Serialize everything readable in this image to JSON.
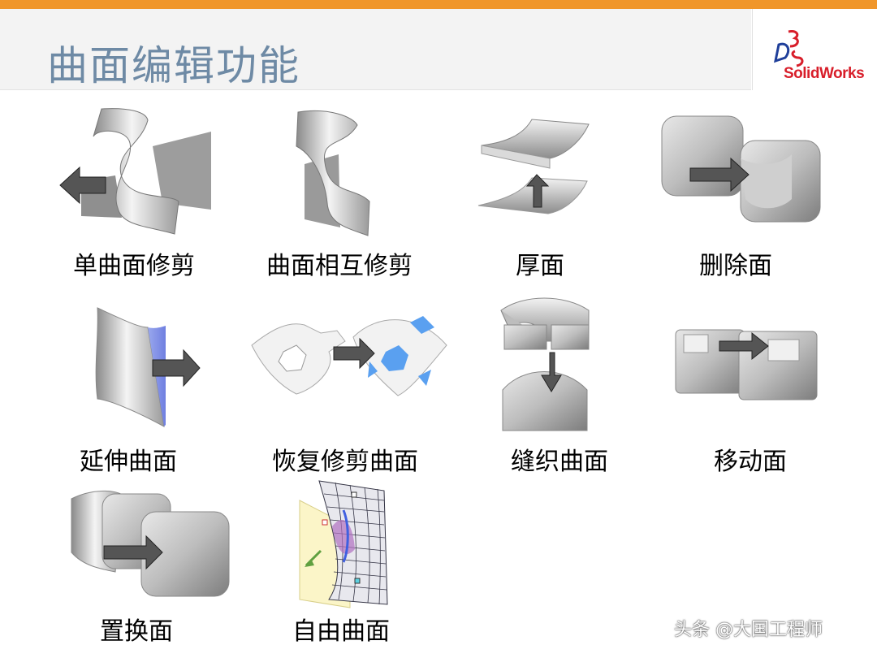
{
  "slide": {
    "title": "曲面编辑功能",
    "logo": {
      "brand": "SolidWorks",
      "mark": "3DS"
    },
    "watermark": "头条 @大国工程师"
  },
  "features": [
    {
      "label": "单曲面修剪",
      "icon": "trim-single-surface-icon"
    },
    {
      "label": "曲面相互修剪",
      "icon": "mutual-trim-surface-icon"
    },
    {
      "label": "厚面",
      "icon": "thicken-surface-icon"
    },
    {
      "label": "删除面",
      "icon": "delete-face-icon"
    },
    {
      "label": "延伸曲面",
      "icon": "extend-surface-icon"
    },
    {
      "label": "恢复修剪曲面",
      "icon": "untrim-surface-icon"
    },
    {
      "label": "缝织曲面",
      "icon": "knit-surface-icon"
    },
    {
      "label": "移动面",
      "icon": "move-face-icon"
    },
    {
      "label": "置换面",
      "icon": "replace-face-icon"
    },
    {
      "label": "自由曲面",
      "icon": "freeform-surface-icon"
    }
  ],
  "colors": {
    "accent_bar": "#f0962a",
    "title_text": "#6e8aa5",
    "logo_red": "#d81e2a",
    "arrow_fill": "#555555",
    "highlight_blue": "#5aa0f0"
  }
}
